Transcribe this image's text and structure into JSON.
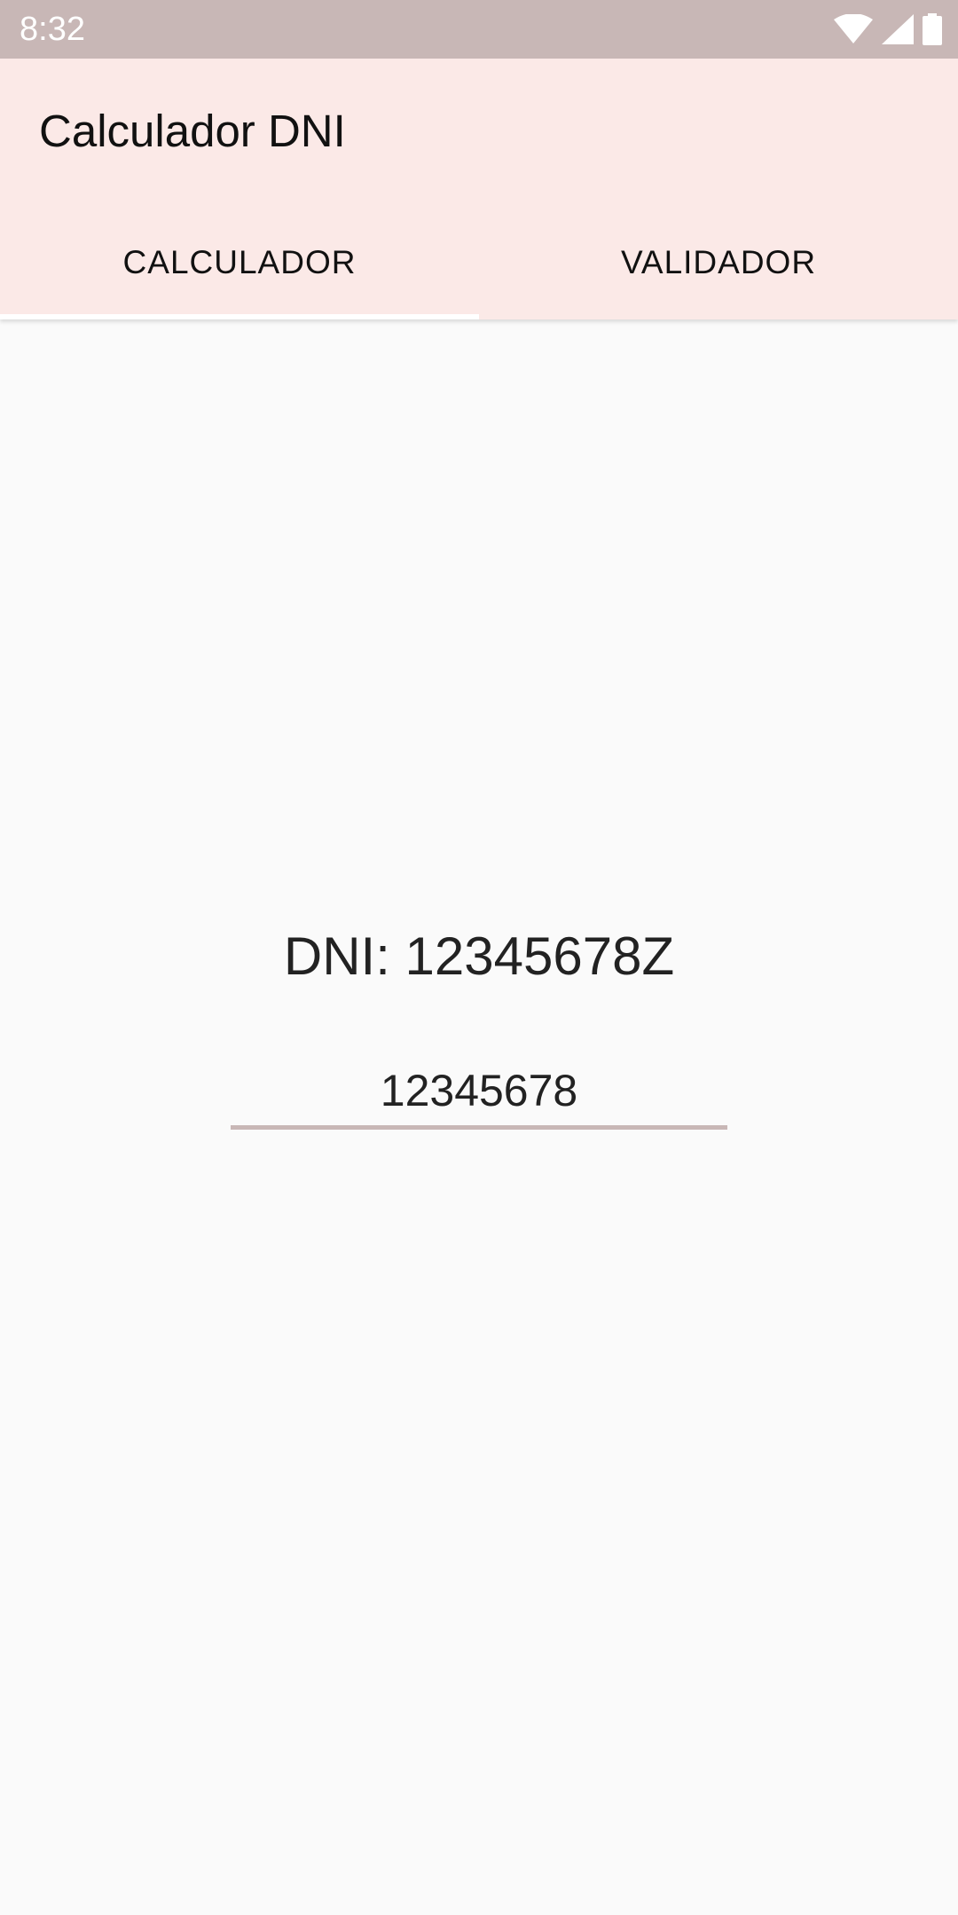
{
  "status_bar": {
    "time": "8:32",
    "icons": [
      "wifi-icon",
      "cell-signal-icon",
      "battery-icon"
    ]
  },
  "app": {
    "title": "Calculador DNI"
  },
  "tabs": [
    {
      "label": "CALCULADOR",
      "selected": true
    },
    {
      "label": "VALIDADOR",
      "selected": false
    }
  ],
  "calculator": {
    "result": "DNI: 12345678Z",
    "input_value": "12345678"
  },
  "colors": {
    "status_bar": "#c8b7b6",
    "header": "#fbe9e7",
    "background": "#fafafa",
    "input_underline": "#c8b7b6"
  }
}
